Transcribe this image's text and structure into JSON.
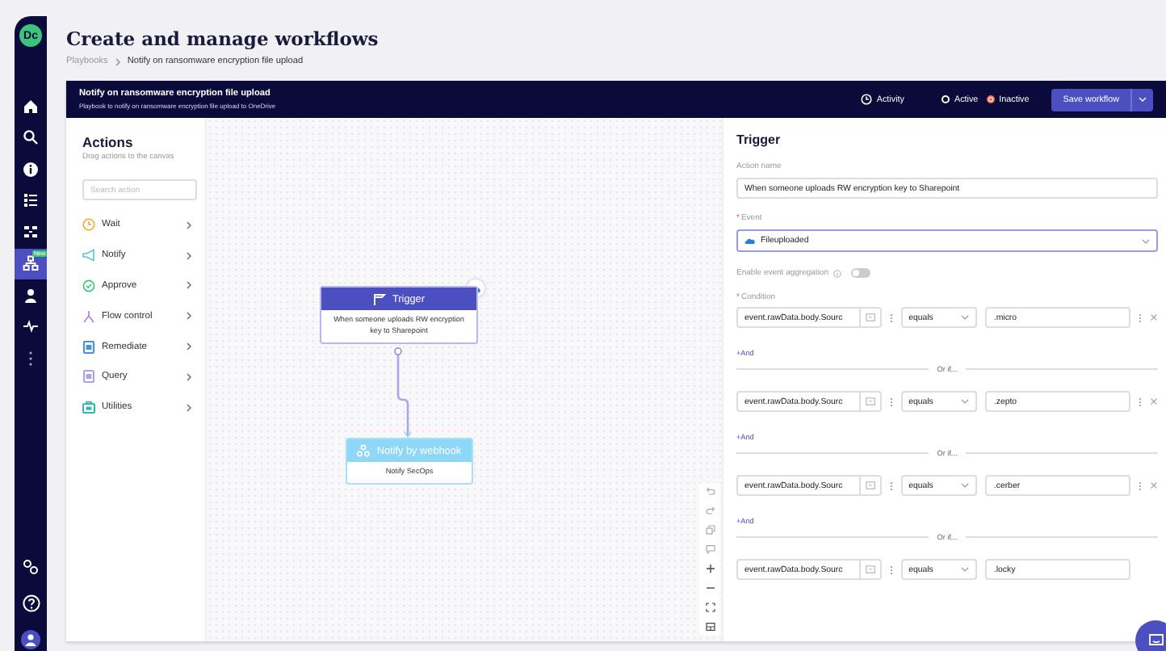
{
  "nav": {
    "logo": "Dc",
    "items": [
      {
        "kind": "home",
        "selected": false
      },
      {
        "kind": "search",
        "selected": false
      },
      {
        "kind": "info",
        "selected": false
      },
      {
        "kind": "list",
        "selected": false
      },
      {
        "kind": "flow",
        "selected": false
      },
      {
        "kind": "tree",
        "selected": true,
        "badge": "New"
      },
      {
        "kind": "person",
        "selected": false
      },
      {
        "kind": "pulse",
        "selected": false
      },
      {
        "kind": "more",
        "selected": false
      }
    ],
    "bottom": [
      {
        "kind": "gears"
      },
      {
        "kind": "help"
      },
      {
        "kind": "avatar"
      }
    ]
  },
  "page": {
    "title": "Create and manage workflows",
    "breadcrumb": [
      "Playbooks",
      "Notify on ransomware encryption file upload"
    ]
  },
  "header": {
    "title": "Notify on ransomware encryption file upload",
    "subtitle": "Playbook to notify on ransomware encryption file upload to OneDrive",
    "activity": "Activity",
    "status": [
      {
        "label": "Active",
        "selected": false
      },
      {
        "label": "Inactive",
        "selected": true
      }
    ],
    "save": "Save workflow"
  },
  "actions": {
    "title": "Actions",
    "hint": "Drag actions to the canvas",
    "search_placeholder": "Search action",
    "items": [
      {
        "label": "Wait",
        "kind": "clock",
        "color": "#f5a623"
      },
      {
        "label": "Notify",
        "kind": "megaphone",
        "color": "#5bc0eb"
      },
      {
        "label": "Approve",
        "kind": "badge",
        "color": "#3cc47c"
      },
      {
        "label": "Flow control",
        "kind": "fork",
        "color": "#b57be0"
      },
      {
        "label": "Remediate",
        "kind": "doc",
        "color": "#4a90e2"
      },
      {
        "label": "Query",
        "kind": "doc",
        "color": "#a9a4e8"
      },
      {
        "label": "Utilities",
        "kind": "tool",
        "color": "#36b6a8"
      }
    ]
  },
  "canvas": {
    "nodes": [
      {
        "kind": "trigger",
        "title": "Trigger",
        "body": "When someone uploads RW encryption key to Sharepoint"
      },
      {
        "kind": "webhook",
        "title": "Notify by webhook",
        "body": "Notify SecOps"
      }
    ]
  },
  "panel": {
    "title": "Trigger",
    "action_name_label": "Action name",
    "action_name": "When someone uploads RW encryption key to Sharepoint",
    "event_required_mark": "*",
    "condition_required_mark": "*",
    "event_label": "Event",
    "event": "Fileuploaded",
    "aggregation_label": "Enable event aggregation",
    "aggregation_on": false,
    "condition_label": "Condition",
    "conditions": [
      {
        "field": "event.rawData.body.Sourc",
        "operator": "equals",
        "value": ".micro",
        "menu": true,
        "and_label": "+And"
      },
      {
        "or_label": "Or if...",
        "field": "event.rawData.body.Sourc",
        "operator": "equals",
        "value": ".zepto",
        "menu": true,
        "and_label": "+And"
      },
      {
        "or_label": "Or if...",
        "field": "event.rawData.body.Sourc",
        "operator": "equals",
        "value": ".cerber",
        "menu": true,
        "and_label": "+And"
      },
      {
        "or_label": "Or if...",
        "field": "event.rawData.body.Sourc",
        "operator": "equals",
        "value": ".locky",
        "menu": false
      }
    ]
  }
}
